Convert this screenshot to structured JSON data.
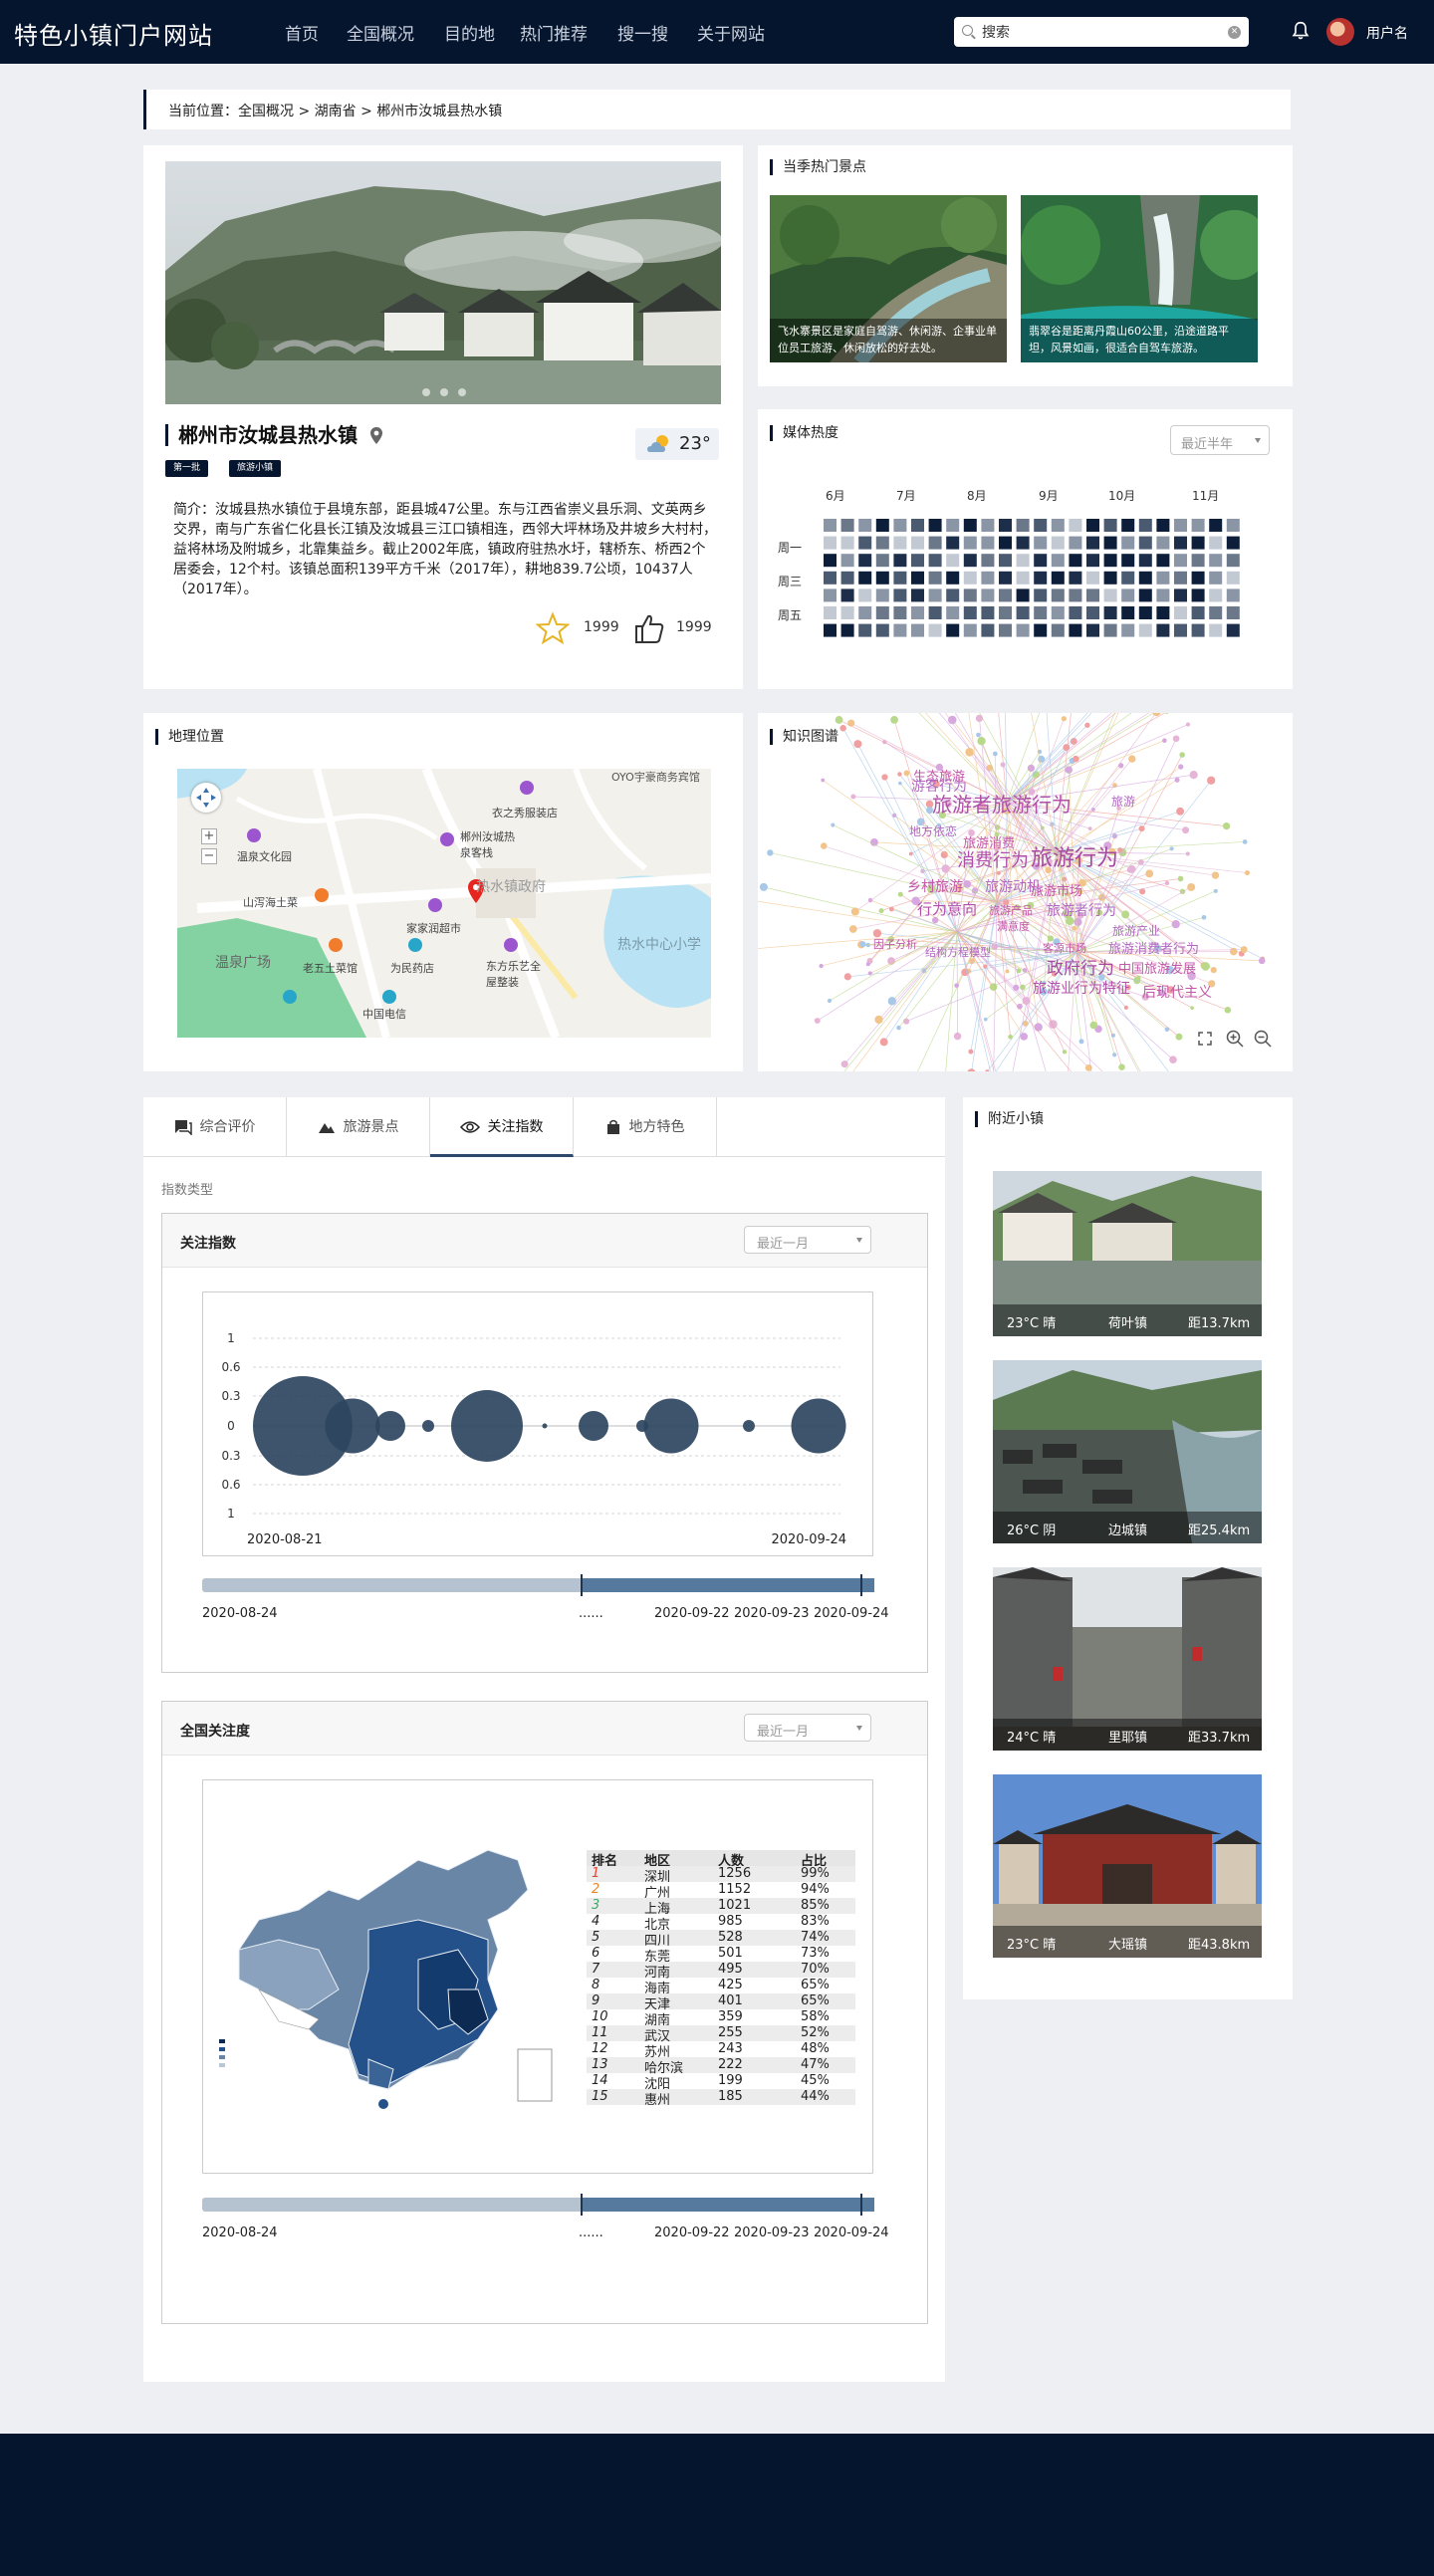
{
  "header": {
    "site_title": "特色小镇门户网站",
    "nav": [
      "首页",
      "全国概况",
      "目的地",
      "热门推荐",
      "搜一搜",
      "关于网站"
    ],
    "search_value": "搜索",
    "username": "用户名"
  },
  "breadcrumb": "当前位置：全国概况 > 湖南省 > 郴州市汝城县热水镇",
  "town": {
    "name": "郴州市汝城县热水镇",
    "tags": [
      "第一批",
      "旅游小镇"
    ],
    "temperature": "23°",
    "intro": "简介：汝城县热水镇位于县境东部，距县城47公里。东与江西省崇义县乐洞、文英两乡交界，南与广东省仁化县长江镇及汝城县三江口镇相连，西邻大坪林场及井坡乡大村村，益将林场及附城乡，北靠集益乡。截止2002年底，镇政府驻热水圩，辖桥东、桥西2个居委会，12个村。该镇总面积139平方千米（2017年），耕地839.7公顷，10437人（2017年）。",
    "favorites": "1999",
    "likes": "1999"
  },
  "hot_spots": {
    "title": "当季热门景点",
    "items": [
      {
        "caption": "飞水寨景区是家庭自驾游、休闲游、企事业单位员工旅游、休闲放松的好去处。"
      },
      {
        "caption": "翡翠谷是距离丹霞山60公里，沿途道路平坦，风景如画，很适合自驾车旅游。"
      }
    ]
  },
  "media_heat": {
    "title": "媒体热度",
    "period": "最近半年",
    "months": [
      "6月",
      "7月",
      "8月",
      "9月",
      "10月",
      "11月"
    ],
    "weekdays": [
      "周一",
      "周三",
      "周五"
    ]
  },
  "map": {
    "title": "地理位置",
    "labels": [
      "OYO宇豪商务宾馆",
      "衣之秀服装店",
      "郴州汝城热泉客栈",
      "温泉文化园",
      "热水镇政府",
      "山泻海土菜",
      "家家润超市",
      "温泉广场",
      "老五土菜馆",
      "为民药店",
      "东方乐艺全屋整装",
      "热水中心小学",
      "中国电信"
    ]
  },
  "knowledge_graph": {
    "title": "知识图谱",
    "terms": [
      "生态旅游",
      "游客行为",
      "旅游者旅游行为",
      "旅游",
      "地方依恋",
      "旅游消费",
      "消费行为",
      "旅游行为",
      "乡村旅游",
      "旅游动机",
      "旅游市场",
      "行为意向",
      "旅游产品",
      "旅游者行为",
      "满意度",
      "旅游产业",
      "因子分析",
      "结构方程模型",
      "客源市场",
      "旅游消费者行为",
      "政府行为",
      "中国旅游发展",
      "旅游业行为特征",
      "后现代主义"
    ]
  },
  "tabs": [
    "综合评价",
    "旅游景点",
    "关注指数",
    "地方特色"
  ],
  "index_type_label": "指数类型",
  "attention_panel": {
    "title": "关注指数",
    "period": "最近一月",
    "y_ticks": [
      "1",
      "0.6",
      "0.3",
      "0",
      "0.3",
      "0.6",
      "1"
    ],
    "x_start": "2020-08-21",
    "x_end": "2020-09-24",
    "slider_labels": [
      "2020-08-24",
      "......",
      "2020-09-22",
      "2020-09-23",
      "2020-09-24"
    ]
  },
  "national_panel": {
    "title": "全国关注度",
    "period": "最近一月",
    "table_headers": [
      "排名",
      "地区",
      "人数",
      "占比"
    ],
    "table_rows": [
      [
        "1",
        "深圳",
        "1256",
        "99%"
      ],
      [
        "2",
        "广州",
        "1152",
        "94%"
      ],
      [
        "3",
        "上海",
        "1021",
        "85%"
      ],
      [
        "4",
        "北京",
        "985",
        "83%"
      ],
      [
        "5",
        "四川",
        "528",
        "74%"
      ],
      [
        "6",
        "东莞",
        "501",
        "73%"
      ],
      [
        "7",
        "河南",
        "495",
        "70%"
      ],
      [
        "8",
        "海南",
        "425",
        "65%"
      ],
      [
        "9",
        "天津",
        "401",
        "65%"
      ],
      [
        "10",
        "湖南",
        "359",
        "58%"
      ],
      [
        "11",
        "武汉",
        "255",
        "52%"
      ],
      [
        "12",
        "苏州",
        "243",
        "48%"
      ],
      [
        "13",
        "哈尔滨",
        "222",
        "47%"
      ],
      [
        "14",
        "沈阳",
        "199",
        "45%"
      ],
      [
        "15",
        "惠州",
        "185",
        "44%"
      ]
    ],
    "slider_labels": [
      "2020-08-24",
      "......",
      "2020-09-22",
      "2020-09-23",
      "2020-09-24"
    ]
  },
  "nearby": {
    "title": "附近小镇",
    "items": [
      {
        "weather": "23°C 晴",
        "name": "荷叶镇",
        "distance": "距13.7km"
      },
      {
        "weather": "26°C 阴",
        "name": "边城镇",
        "distance": "距25.4km"
      },
      {
        "weather": "24°C 晴",
        "name": "里耶镇",
        "distance": "距33.7km"
      },
      {
        "weather": "23°C 晴",
        "name": "大瑶镇",
        "distance": "距43.8km"
      }
    ]
  },
  "chart_data": {
    "type": "scatter",
    "title": "关注指数",
    "x": [
      "2020-08-21",
      "2020-08-23",
      "2020-08-25",
      "2020-08-27",
      "2020-08-30",
      "2020-09-02",
      "2020-09-06",
      "2020-09-09",
      "2020-09-12",
      "2020-09-17",
      "2020-09-24"
    ],
    "values": [
      1.0,
      0.55,
      0.3,
      0.12,
      0.72,
      0.05,
      0.3,
      0.12,
      0.55,
      0.12,
      0.55
    ],
    "xlabel": "",
    "ylabel": "",
    "ylim": [
      -1,
      1
    ],
    "grid": true
  },
  "colors": {
    "navy": "#06152e",
    "bubble": "#2d4560",
    "slider": "#567a9e"
  }
}
